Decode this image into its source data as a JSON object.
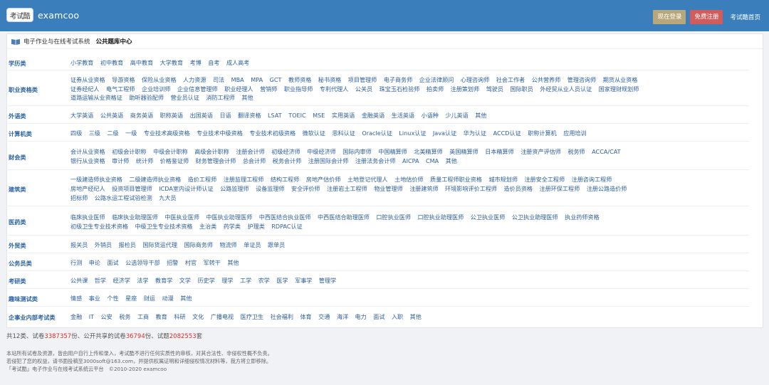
{
  "header": {
    "logo_text": "考试酷",
    "brand": "examcoo",
    "login": "现在登录",
    "register": "免费注册",
    "home": "考试酷首页"
  },
  "panel": {
    "crumb": "电子作业与在线考试系统",
    "active": "公共题库中心"
  },
  "categories": [
    {
      "label": "学历类",
      "lines": [
        [
          "小学教育",
          "初中教育",
          "高中教育",
          "大学教育",
          "考博",
          "自考",
          "成人高考"
        ]
      ]
    },
    {
      "label": "职业资格类",
      "lines": [
        [
          "证券从业资格",
          "导游资格",
          "保险从业资格",
          "人力资源",
          "司法",
          "MBA",
          "MPA",
          "GCT",
          "教师资格",
          "秘书资格",
          "项目管理师",
          "电子商务师",
          "企业法律顾问",
          "心理咨询师",
          "社会工作者",
          "公共营养师",
          "管理咨询师",
          "期货从业资格"
        ],
        [
          "证券经纪人",
          "电气工程师",
          "企业培训师",
          "企业信息管理师",
          "职业经理人",
          "营销师",
          "职业指导师",
          "专利代理人",
          "公关员",
          "珠宝玉石检验师",
          "拍卖师",
          "注册策划师",
          "驾驶员",
          "国际职员",
          "外经贸从业人员认证",
          "国家理财规划师"
        ],
        [
          "道路运输从业资格证",
          "助听器验配师",
          "营业员认证",
          "消防工程师",
          "其他"
        ]
      ]
    },
    {
      "label": "外语类",
      "lines": [
        [
          "大学英语",
          "公共英语",
          "商务英语",
          "职称英语",
          "出国英语",
          "日语",
          "翻译资格",
          "LSAT",
          "TOEIC",
          "MSE",
          "实用英语",
          "金融英语",
          "生活英语",
          "小语种",
          "少儿英语",
          "其他"
        ]
      ]
    },
    {
      "label": "计算机类",
      "lines": [
        [
          "四级",
          "三级",
          "二级",
          "一级",
          "专业技术高级资格",
          "专业技术中级资格",
          "专业技术初级资格",
          "微软认证",
          "思科认证",
          "Oracle认证",
          "Linux认证",
          "Java认证",
          "华为认证",
          "ACCD认证",
          "职称计算机",
          "应用培训"
        ]
      ]
    },
    {
      "label": "财会类",
      "lines": [
        [
          "会计从业资格",
          "初级会计职称",
          "中级会计职称",
          "高级会计职称",
          "注册会计师",
          "初级经济师",
          "中级经济师",
          "国际内审师",
          "中国精算师",
          "北美精算师",
          "英国精算师",
          "日本精算师",
          "注册资产评估师",
          "税务师",
          "ACCA/CAT"
        ],
        [
          "银行从业资格",
          "审计师",
          "统计师",
          "价格鉴证师",
          "财务管理会计师",
          "总会计师",
          "税务会计师",
          "注册国际会计师",
          "注册法务会计师",
          "AICPA",
          "CMA",
          "其他"
        ]
      ]
    },
    {
      "label": "建筑类",
      "lines": [
        [
          "一级建造师执业资格",
          "二级建造师执业资格",
          "造价工程师",
          "注册监理工程师",
          "结构工程师",
          "房地产估价师",
          "土地登记代理人",
          "土地估价师",
          "质量工程师职业资格",
          "城市规划师",
          "注册安全工程师",
          "注册咨询工程师"
        ],
        [
          "房地产经纪人",
          "投资项目管理师",
          "ICDA室内设计师认证",
          "公路监理师",
          "设备监理师",
          "安全评价师",
          "注册岩土工程师",
          "物业管理师",
          "注册建筑师",
          "环境影响评价工程师",
          "造价员资格",
          "注册环保工程师",
          "注册公路造价师"
        ],
        [
          "招标师",
          "公路水运工程试验检测",
          "九大员"
        ]
      ]
    },
    {
      "label": "医药类",
      "lines": [
        [
          "临床执业医师",
          "临床执业助理医师",
          "中医执业医师",
          "中医执业助理医师",
          "中西医结合执业医师",
          "中西医结合助理医师",
          "口腔执业医师",
          "口腔执业助理医师",
          "公卫执业医师",
          "公卫执业助理医师",
          "执业药师资格"
        ],
        [
          "初级卫生专业技术资格",
          "中级卫生专业技术资格",
          "主治类",
          "药学类",
          "护理类",
          "RDPAC认证"
        ]
      ]
    },
    {
      "label": "外贸类",
      "lines": [
        [
          "报关员",
          "外销员",
          "报检员",
          "国际货运代理",
          "国际商务师",
          "物流师",
          "单证员",
          "跟单员"
        ]
      ]
    },
    {
      "label": "公务员类",
      "lines": [
        [
          "行测",
          "申论",
          "面试",
          "公选领导干部",
          "招警",
          "村官",
          "军转干",
          "其他"
        ]
      ]
    },
    {
      "label": "考研类",
      "lines": [
        [
          "公共课",
          "哲学",
          "经济学",
          "法学",
          "教育学",
          "文学",
          "历史学",
          "理学",
          "工学",
          "农学",
          "医学",
          "军事学",
          "管理学"
        ]
      ]
    },
    {
      "label": "趣味测试类",
      "lines": [
        [
          "情感",
          "事业",
          "个性",
          "星座",
          "财运",
          "动漫",
          "其他"
        ]
      ]
    },
    {
      "label": "企事业内部考试类",
      "lines": [
        [
          "金融",
          "IT",
          "公安",
          "税务",
          "工商",
          "教育",
          "科研",
          "文化",
          "广播电视",
          "医疗卫生",
          "社会福利",
          "体育",
          "交通",
          "海洋",
          "电力",
          "面试",
          "入职",
          "其他"
        ]
      ]
    }
  ],
  "summary": {
    "prefix": "共12类、试卷",
    "papers": "3387357",
    "mid1": "份、公开共享的试卷",
    "shared": "36794",
    "mid2": "份、试题",
    "questions": "2082553",
    "suffix": "套"
  },
  "footer": {
    "line1": "本站所有试卷及资源，皆由用户自行上传和录入，考试酷不进行任何实质性的审核，对其合法性、非侵权性概不负责。",
    "line2": "若侵犯了您的权益，请书面投稿至3000soft@163.com，并提供权属证明和详细侵权情况材料等，我方将立即移除。",
    "line3": "「考试酷」电子作业与在线考试系统云平台　©2010-2020 examcoo"
  }
}
